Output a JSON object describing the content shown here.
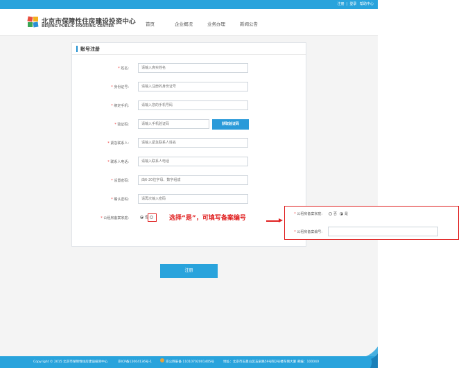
{
  "header": {
    "links": [
      "注册",
      "|",
      "登录",
      "帮助中心"
    ],
    "logo_cn": "北京市保障性住房建设投资中心",
    "logo_en": "BEIJING PUBLIC HOUSING CENTER",
    "menu": [
      "首页",
      "企业概况",
      "业务办理",
      "新闻公告"
    ]
  },
  "form": {
    "title": "账号注册",
    "fields": [
      {
        "label": "姓名:",
        "placeholder": "请输入真实姓名"
      },
      {
        "label": "身份证号:",
        "placeholder": "请输入注册的身份证号"
      },
      {
        "label": "绑定手机:",
        "placeholder": "请输入您的手机号码"
      },
      {
        "label": "验证码:",
        "placeholder": "请输入手机验证码"
      },
      {
        "label": "紧急联系人:",
        "placeholder": "请输入紧急联系人姓名"
      },
      {
        "label": "联系人电话:",
        "placeholder": "请输入联系人电话"
      },
      {
        "label": "设置密码:",
        "placeholder": "由6-20位字母、数字组成"
      },
      {
        "label": "确认密码:",
        "placeholder": "请再次输入密码"
      }
    ],
    "sms_button": "获取验证码",
    "public_rental_label": "公租房备案家庭:",
    "option_no": "否",
    "option_yes": "是",
    "submit": "注册"
  },
  "annotation": "选择“是”，可填写备案编号",
  "zoom_panel": {
    "family_label": "公租房备案家庭:",
    "option_no": "否",
    "option_yes": "是",
    "number_label": "公租房备案编号:",
    "selected": "是"
  },
  "footer": {
    "copyright": "Copyright © 2015 北京市保障性住房建设投资中心",
    "icp": "京ICP备12004136号-1",
    "police": "京公网安备 11010702001405号",
    "address": "地址：北京市石景山区玉泉路59号院2号楼东侧大厦 邮编：100040"
  },
  "colors": {
    "primary": "#29a3dc",
    "annotation": "#e02020"
  }
}
